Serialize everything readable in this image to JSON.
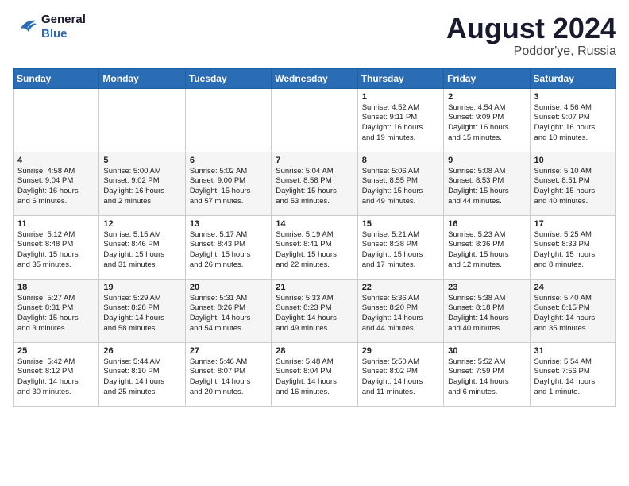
{
  "header": {
    "logo_line1": "General",
    "logo_line2": "Blue",
    "month_year": "August 2024",
    "location": "Poddor'ye, Russia"
  },
  "days_of_week": [
    "Sunday",
    "Monday",
    "Tuesday",
    "Wednesday",
    "Thursday",
    "Friday",
    "Saturday"
  ],
  "weeks": [
    [
      {
        "day": "",
        "info": ""
      },
      {
        "day": "",
        "info": ""
      },
      {
        "day": "",
        "info": ""
      },
      {
        "day": "",
        "info": ""
      },
      {
        "day": "1",
        "info": "Sunrise: 4:52 AM\nSunset: 9:11 PM\nDaylight: 16 hours\nand 19 minutes."
      },
      {
        "day": "2",
        "info": "Sunrise: 4:54 AM\nSunset: 9:09 PM\nDaylight: 16 hours\nand 15 minutes."
      },
      {
        "day": "3",
        "info": "Sunrise: 4:56 AM\nSunset: 9:07 PM\nDaylight: 16 hours\nand 10 minutes."
      }
    ],
    [
      {
        "day": "4",
        "info": "Sunrise: 4:58 AM\nSunset: 9:04 PM\nDaylight: 16 hours\nand 6 minutes."
      },
      {
        "day": "5",
        "info": "Sunrise: 5:00 AM\nSunset: 9:02 PM\nDaylight: 16 hours\nand 2 minutes."
      },
      {
        "day": "6",
        "info": "Sunrise: 5:02 AM\nSunset: 9:00 PM\nDaylight: 15 hours\nand 57 minutes."
      },
      {
        "day": "7",
        "info": "Sunrise: 5:04 AM\nSunset: 8:58 PM\nDaylight: 15 hours\nand 53 minutes."
      },
      {
        "day": "8",
        "info": "Sunrise: 5:06 AM\nSunset: 8:55 PM\nDaylight: 15 hours\nand 49 minutes."
      },
      {
        "day": "9",
        "info": "Sunrise: 5:08 AM\nSunset: 8:53 PM\nDaylight: 15 hours\nand 44 minutes."
      },
      {
        "day": "10",
        "info": "Sunrise: 5:10 AM\nSunset: 8:51 PM\nDaylight: 15 hours\nand 40 minutes."
      }
    ],
    [
      {
        "day": "11",
        "info": "Sunrise: 5:12 AM\nSunset: 8:48 PM\nDaylight: 15 hours\nand 35 minutes."
      },
      {
        "day": "12",
        "info": "Sunrise: 5:15 AM\nSunset: 8:46 PM\nDaylight: 15 hours\nand 31 minutes."
      },
      {
        "day": "13",
        "info": "Sunrise: 5:17 AM\nSunset: 8:43 PM\nDaylight: 15 hours\nand 26 minutes."
      },
      {
        "day": "14",
        "info": "Sunrise: 5:19 AM\nSunset: 8:41 PM\nDaylight: 15 hours\nand 22 minutes."
      },
      {
        "day": "15",
        "info": "Sunrise: 5:21 AM\nSunset: 8:38 PM\nDaylight: 15 hours\nand 17 minutes."
      },
      {
        "day": "16",
        "info": "Sunrise: 5:23 AM\nSunset: 8:36 PM\nDaylight: 15 hours\nand 12 minutes."
      },
      {
        "day": "17",
        "info": "Sunrise: 5:25 AM\nSunset: 8:33 PM\nDaylight: 15 hours\nand 8 minutes."
      }
    ],
    [
      {
        "day": "18",
        "info": "Sunrise: 5:27 AM\nSunset: 8:31 PM\nDaylight: 15 hours\nand 3 minutes."
      },
      {
        "day": "19",
        "info": "Sunrise: 5:29 AM\nSunset: 8:28 PM\nDaylight: 14 hours\nand 58 minutes."
      },
      {
        "day": "20",
        "info": "Sunrise: 5:31 AM\nSunset: 8:26 PM\nDaylight: 14 hours\nand 54 minutes."
      },
      {
        "day": "21",
        "info": "Sunrise: 5:33 AM\nSunset: 8:23 PM\nDaylight: 14 hours\nand 49 minutes."
      },
      {
        "day": "22",
        "info": "Sunrise: 5:36 AM\nSunset: 8:20 PM\nDaylight: 14 hours\nand 44 minutes."
      },
      {
        "day": "23",
        "info": "Sunrise: 5:38 AM\nSunset: 8:18 PM\nDaylight: 14 hours\nand 40 minutes."
      },
      {
        "day": "24",
        "info": "Sunrise: 5:40 AM\nSunset: 8:15 PM\nDaylight: 14 hours\nand 35 minutes."
      }
    ],
    [
      {
        "day": "25",
        "info": "Sunrise: 5:42 AM\nSunset: 8:12 PM\nDaylight: 14 hours\nand 30 minutes."
      },
      {
        "day": "26",
        "info": "Sunrise: 5:44 AM\nSunset: 8:10 PM\nDaylight: 14 hours\nand 25 minutes."
      },
      {
        "day": "27",
        "info": "Sunrise: 5:46 AM\nSunset: 8:07 PM\nDaylight: 14 hours\nand 20 minutes."
      },
      {
        "day": "28",
        "info": "Sunrise: 5:48 AM\nSunset: 8:04 PM\nDaylight: 14 hours\nand 16 minutes."
      },
      {
        "day": "29",
        "info": "Sunrise: 5:50 AM\nSunset: 8:02 PM\nDaylight: 14 hours\nand 11 minutes."
      },
      {
        "day": "30",
        "info": "Sunrise: 5:52 AM\nSunset: 7:59 PM\nDaylight: 14 hours\nand 6 minutes."
      },
      {
        "day": "31",
        "info": "Sunrise: 5:54 AM\nSunset: 7:56 PM\nDaylight: 14 hours\nand 1 minute."
      }
    ]
  ]
}
